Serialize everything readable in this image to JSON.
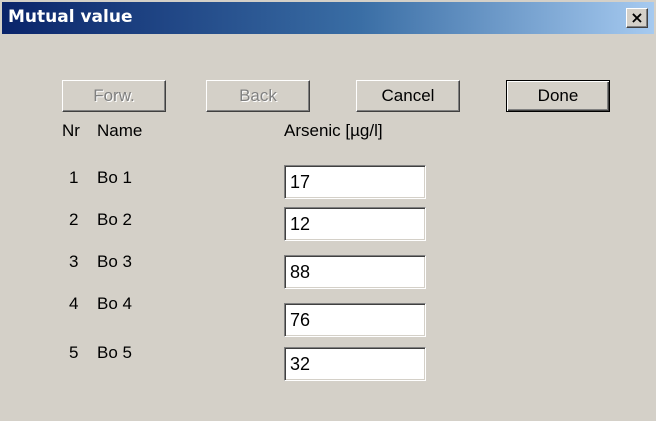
{
  "window": {
    "title": "Mutual value",
    "close_glyph": "×"
  },
  "buttons": {
    "forward": "Forw.",
    "back": "Back",
    "cancel": "Cancel",
    "done": "Done"
  },
  "table": {
    "headers": {
      "nr": "Nr",
      "name": "Name",
      "value": "Arsenic [µg/l]"
    },
    "rows": [
      {
        "nr": "1",
        "name": "Bo 1",
        "value": "17"
      },
      {
        "nr": "2",
        "name": "Bo 2",
        "value": "12"
      },
      {
        "nr": "3",
        "name": "Bo 3",
        "value": "88"
      },
      {
        "nr": "4",
        "name": "Bo 4",
        "value": "76"
      },
      {
        "nr": "5",
        "name": "Bo 5",
        "value": "32"
      }
    ]
  },
  "icons": {
    "close": "close-icon"
  },
  "colors": {
    "dialog_background": "#d4d0c8",
    "titlebar_start": "#0a246a",
    "titlebar_end": "#a6caf0",
    "disabled_text": "#808080"
  }
}
